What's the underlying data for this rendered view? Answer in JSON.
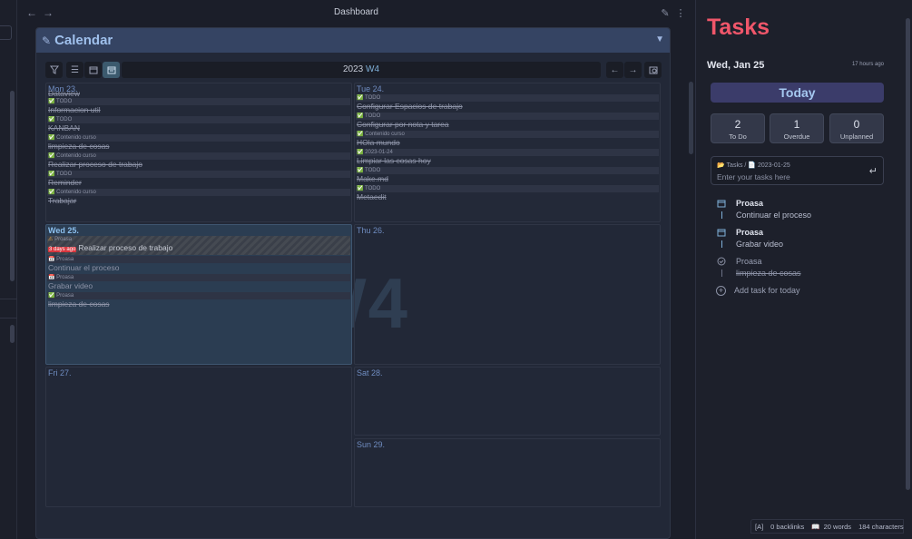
{
  "topbar": {
    "title": "Dashboard",
    "back": "←",
    "forward": "→",
    "edit_icon": "✎",
    "more_icon": "⋮"
  },
  "calendar": {
    "title": "Calendar",
    "toolbar_title_year": "2023",
    "toolbar_title_week": "W4",
    "watermark": "W4",
    "days": {
      "mon": {
        "label": "Mon 23.",
        "tasks": [
          {
            "tag": "",
            "text": "Dataview",
            "done": true
          },
          {
            "tag": "TODO",
            "text": "Informacion util",
            "done": true
          },
          {
            "tag": "TODO",
            "text": "KANBAN",
            "done": true
          },
          {
            "tag": "Contenido curso",
            "text": "limpieza de cosas",
            "done": true
          },
          {
            "tag": "Contenido curso",
            "text": "Realizar proceso de trabajo",
            "done": true
          },
          {
            "tag": "TODO",
            "text": "Reminder",
            "done": true
          },
          {
            "tag": "Contenido curso",
            "text": "Trabajar",
            "done": true
          }
        ]
      },
      "tue": {
        "label": "Tue 24.",
        "tasks": [
          {
            "tag": "TODO",
            "text": "Configurar Espacios de trabajo",
            "done": true
          },
          {
            "tag": "TODO",
            "text": "Configurar por nota y tarea",
            "done": true
          },
          {
            "tag": "Contenido curso",
            "text": "HOla mundo",
            "done": true
          },
          {
            "tag": "2023-01-24",
            "text": "Limpiar las cosas hoy",
            "done": true
          },
          {
            "tag": "TODO",
            "text": "Make.md",
            "done": true
          },
          {
            "tag": "TODO",
            "text": "Metaedit",
            "done": true
          }
        ]
      },
      "wed": {
        "label": "Wed 25.",
        "overdue": {
          "tag": "Proasa",
          "late": "3 days ago",
          "text": "Realizar proceso de trabajo"
        },
        "tasks": [
          {
            "tag": "Proasa",
            "text": "Continuar el proceso",
            "done": false
          },
          {
            "tag": "Proasa",
            "text": "Grabar video",
            "done": false
          },
          {
            "tag": "Proasa",
            "text": "limpieza de cosas",
            "done": true
          }
        ]
      },
      "thu": {
        "label": "Thu 26."
      },
      "fri": {
        "label": "Fri 27."
      },
      "sat": {
        "label": "Sat 28."
      },
      "sun": {
        "label": "Sun 29."
      }
    }
  },
  "tasks_pane": {
    "title": "Tasks",
    "date": "Wed, Jan 25",
    "updated": "17 hours ago",
    "today_button": "Today",
    "stats": [
      {
        "value": "2",
        "label": "To Do"
      },
      {
        "value": "1",
        "label": "Overdue"
      },
      {
        "value": "0",
        "label": "Unplanned"
      }
    ],
    "input_path_folder": "Tasks",
    "input_path_sep": "/",
    "input_path_file": "2023-01-25",
    "input_placeholder": "Enter your tasks here",
    "items": [
      {
        "project": "Proasa",
        "text": "Continuar el proceso",
        "done": false
      },
      {
        "project": "Proasa",
        "text": "Grabar video",
        "done": false
      },
      {
        "project": "Proasa",
        "text": "limpieza de cosas",
        "done": true
      }
    ],
    "add_task": "Add task for today"
  },
  "statusbar": {
    "mode": "[A]",
    "backlinks": "0 backlinks",
    "words": "20 words",
    "chars": "184 characters"
  }
}
